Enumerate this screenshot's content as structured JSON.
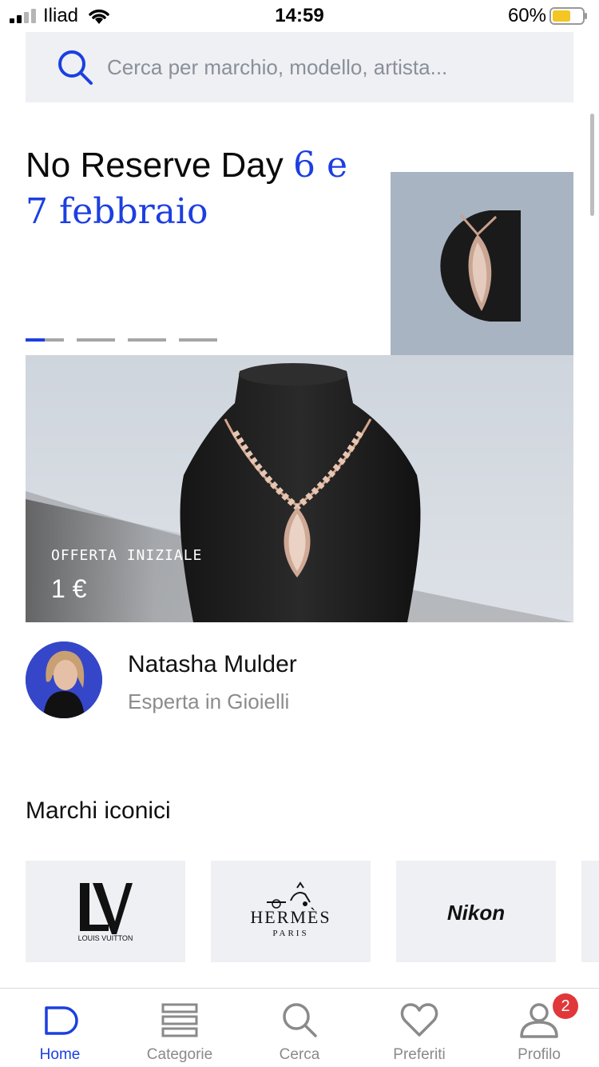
{
  "status_bar": {
    "carrier": "Iliad",
    "time": "14:59",
    "battery": "60%"
  },
  "search": {
    "placeholder": "Cerca per marchio, modello, artista..."
  },
  "hero": {
    "title_plain": "No Reserve Day",
    "title_accent": "6 e 7 febbraio",
    "slides_total": 4,
    "active_slide": 1
  },
  "product": {
    "offer_label": "OFFERTA INIZIALE",
    "offer_price": "1 €"
  },
  "expert": {
    "name": "Natasha Mulder",
    "role": "Esperta in Gioielli"
  },
  "brands": {
    "title": "Marchi iconici",
    "items": [
      {
        "name": "LOUIS VUITTON"
      },
      {
        "name": "HERMÈS",
        "sub": "PARIS"
      },
      {
        "name": "Nikon"
      }
    ]
  },
  "tab_bar": {
    "tabs": [
      {
        "label": "Home",
        "icon": "home-icon",
        "active": true
      },
      {
        "label": "Categorie",
        "icon": "categories-icon"
      },
      {
        "label": "Cerca",
        "icon": "search-icon"
      },
      {
        "label": "Preferiti",
        "icon": "heart-icon"
      },
      {
        "label": "Profilo",
        "icon": "profile-icon",
        "badge": "2"
      }
    ]
  },
  "colors": {
    "accent": "#1c3fe0",
    "badge": "#e0383a",
    "card_bg": "#eef0f4"
  }
}
